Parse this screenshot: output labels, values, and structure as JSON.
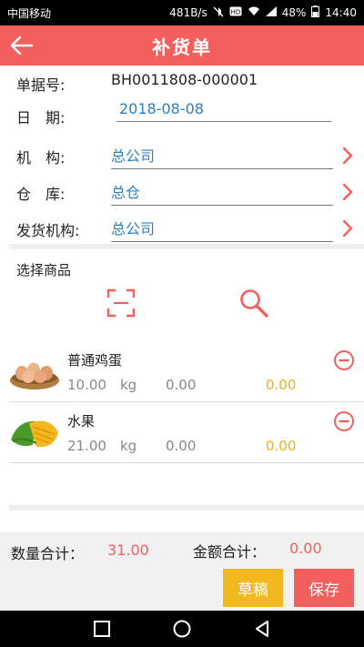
{
  "status_bar": {
    "carrier": "中国移动",
    "speed": "481B/s",
    "battery": "48%",
    "time": "14:40",
    "icons": [
      "mute-icon",
      "hd-icon",
      "wifi-icon",
      "signal-icon",
      "battery-icon"
    ]
  },
  "header": {
    "title": "补货单",
    "back_icon": "arrow-left-icon"
  },
  "form": {
    "doc_no": {
      "label": "单据号:",
      "value": "BH0011808-000001"
    },
    "date": {
      "label": "日　期:",
      "value": "2018-08-08"
    },
    "org": {
      "label": "机　构:",
      "value": "总公司"
    },
    "warehouse": {
      "label": "仓　库:",
      "value": "总仓"
    },
    "ship_org": {
      "label": "发货机构:",
      "value": "总公司"
    }
  },
  "goods": {
    "title": "选择商品",
    "scan_icon": "scan-icon",
    "search_icon": "search-icon",
    "items": [
      {
        "name": "普通鸡蛋",
        "qty": "10.00",
        "unit": "kg",
        "price": "0.00",
        "amount": "0.00"
      },
      {
        "name": "水果",
        "qty": "21.00",
        "unit": "kg",
        "price": "0.00",
        "amount": "0.00"
      }
    ]
  },
  "footer": {
    "qty_label": "数量合计：",
    "qty_total": "31.00",
    "amount_label": "金额合计：",
    "amount_total": "0.00",
    "draft_label": "草稿",
    "save_label": "保存"
  },
  "colors": {
    "accent": "#f25f5c",
    "link": "#2a7fc9",
    "yellow": "#f2b820"
  }
}
